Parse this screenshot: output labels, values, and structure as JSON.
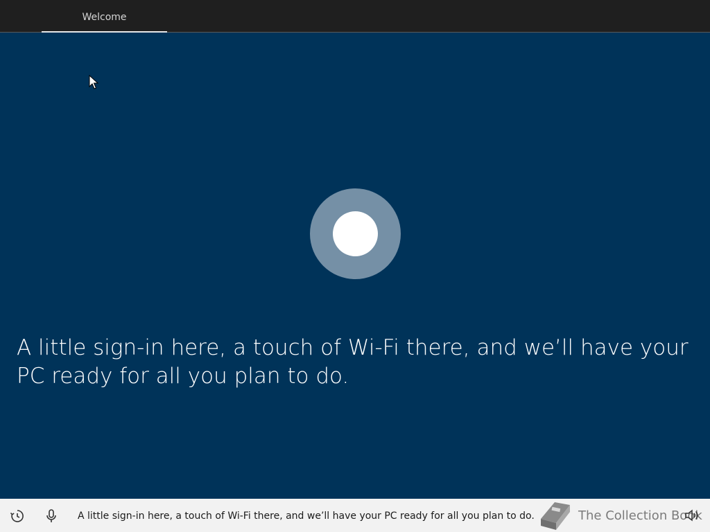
{
  "header": {
    "tabs": [
      {
        "label": "Welcome",
        "active": true
      }
    ]
  },
  "main": {
    "message": "A little sign-in here, a touch of Wi-Fi there, and we’ll have your PC ready for all you plan to do."
  },
  "bottom_bar": {
    "caption": "A little sign-in here, a touch of Wi-Fi there, and we’ll have your PC ready for all you plan to do.",
    "watermark": "The Collection Book",
    "icons": [
      "accessibility-icon",
      "microphone-icon",
      "book-icon",
      "volume-icon"
    ]
  },
  "colors": {
    "background": "#003359",
    "topbar": "#1f1f1f",
    "bottombar": "#f2f2f2",
    "cortana_ring": "#7590a6",
    "cortana_core": "#ffffff"
  }
}
